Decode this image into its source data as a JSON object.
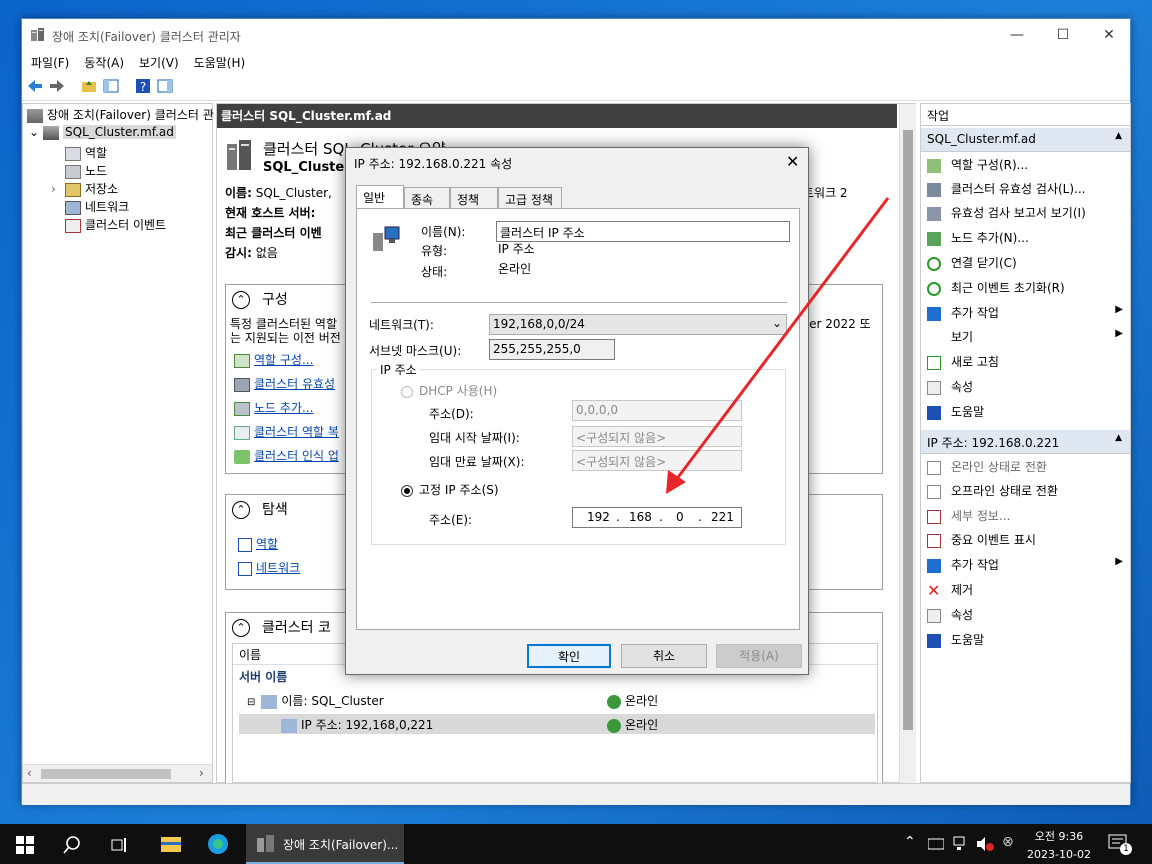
{
  "window": {
    "title": "장애 조치(Failover) 클러스터 관리자",
    "minimize": "—",
    "maximize": "☐",
    "close": "✕"
  },
  "menu": [
    "파일(F)",
    "동작(A)",
    "보기(V)",
    "도움말(H)"
  ],
  "tree": {
    "root": "장애 조치(Failover) 클러스터 관",
    "cluster": "SQL_Cluster.mf.ad",
    "children": [
      "역할",
      "노드",
      "저장소",
      "네트워크",
      "클러스터 이벤트"
    ]
  },
  "mid": {
    "header": "클러스터 SQL_Cluster.mf.ad",
    "summary_title": "클러스터 SQL_Cluster 요약",
    "summary_sub": "SQL_Cluster",
    "info": [
      {
        "k": "이름:",
        "v": "SQL_Cluster,"
      },
      {
        "k": "현재 호스트 서버:",
        "v": ""
      },
      {
        "k": "최근 클러스터 이벤",
        "v": ""
      },
      {
        "k": "감시:",
        "v": "없음"
      }
    ],
    "info_right": "트워크 2",
    "config": {
      "title": "구성",
      "desc1": "특정 클러스터된 역할",
      "desc2": "는 지원되는 이전 버전",
      "desc_right": "ver 2022 또",
      "links": [
        "역할 구성...",
        "클러스터 유효성",
        "노드 추가...",
        "클러스터 역할 복",
        "클러스터 인식 업"
      ]
    },
    "nav": {
      "title": "탐색",
      "links": [
        "역할",
        "네트워크"
      ]
    },
    "core": {
      "title": "클러스터 코",
      "col_name": "이름",
      "group": "서버 이름",
      "rows": [
        {
          "name": "이름: SQL_Cluster",
          "status": "온라인"
        },
        {
          "name": "IP 주소: 192,168,0,221",
          "status": "온라인"
        }
      ]
    }
  },
  "actions": {
    "title": "작업",
    "group1": {
      "title": "SQL_Cluster.mf.ad",
      "items": [
        "역할 구성(R)...",
        "클러스터 유효성 검사(L)...",
        "유효성 검사 보고서 보기(I)",
        "노드 추가(N)...",
        "연결 닫기(C)",
        "최근 이벤트 초기화(R)",
        "추가 작업",
        "보기",
        "새로 고침",
        "속성",
        "도움말"
      ]
    },
    "group2": {
      "title": "IP 주소: 192.168.0.221",
      "items": [
        "온라인 상태로 전환",
        "오프라인 상태로 전환",
        "세부 정보...",
        "중요 이벤트 표시",
        "추가 작업",
        "제거",
        "속성",
        "도움말"
      ]
    }
  },
  "dialog": {
    "title": "IP 주소: 192.168.0.221 속성",
    "tabs": [
      "일반",
      "종속성",
      "정책",
      "고급 정책"
    ],
    "name_label": "이름(N):",
    "name_value": "클러스터 IP 주소",
    "type_label": "유형:",
    "type_value": "IP 주소",
    "state_label": "상태:",
    "state_value": "온라인",
    "network_label": "네트워크(T):",
    "network_value": "192,168,0,0/24",
    "subnet_label": "서브넷 마스크(U):",
    "subnet_value": "255,255,255,0",
    "ip_group": "IP 주소",
    "dhcp_label": "DHCP 사용(H)",
    "dhcp_addr_label": "주소(D):",
    "dhcp_addr_value": "0,0,0,0",
    "lease_start_label": "임대 시작 날짜(I):",
    "lease_start_value": "<구성되지 않음>",
    "lease_end_label": "임대 만료 날짜(X):",
    "lease_end_value": "<구성되지 않음>",
    "static_label": "고정 IP 주소(S)",
    "addr_label": "주소(E):",
    "ip": [
      "192",
      "168",
      "0",
      "221"
    ],
    "ok": "확인",
    "cancel": "취소",
    "apply": "적용(A)"
  },
  "taskbar": {
    "app": "장애 조치(Failover)...",
    "time": "오전 9:36",
    "date": "2023-10-02",
    "notif": "1"
  }
}
